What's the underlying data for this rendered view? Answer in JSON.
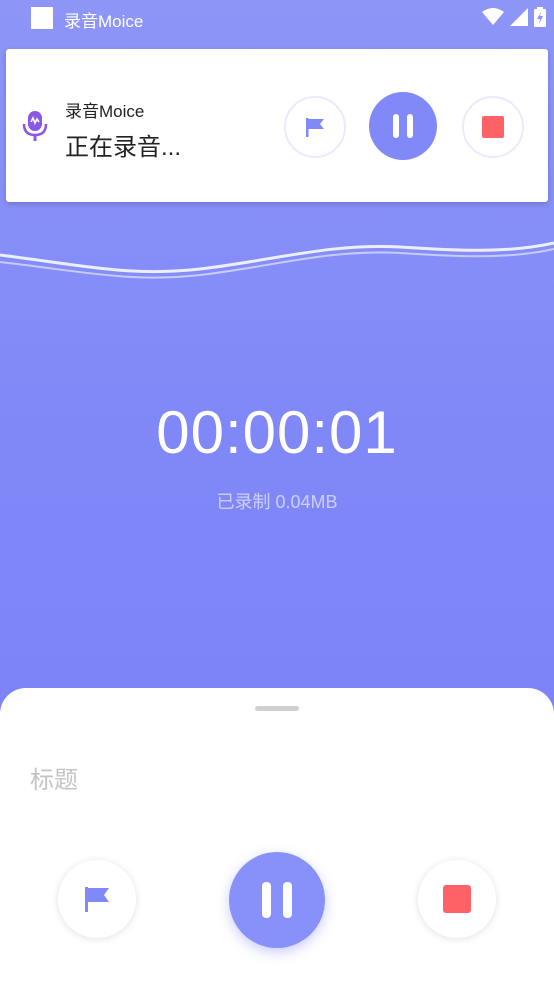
{
  "status_bar": {
    "app_title": "录音Moice"
  },
  "notification": {
    "app_name": "录音Moice",
    "message": "正在录音..."
  },
  "recording": {
    "elapsed": "00:00:01",
    "size_text": "已录制 0.04MB",
    "state": "recording"
  },
  "sheet": {
    "title_placeholder": "标题"
  },
  "colors": {
    "accent": "#8189f8",
    "stop": "#ff6266",
    "background_top": "#8d96f7",
    "background_bottom": "#7780f8"
  },
  "icons": {
    "flag": "flag-icon",
    "pause": "pause-icon",
    "stop": "stop-icon",
    "mic": "microphone-icon"
  }
}
